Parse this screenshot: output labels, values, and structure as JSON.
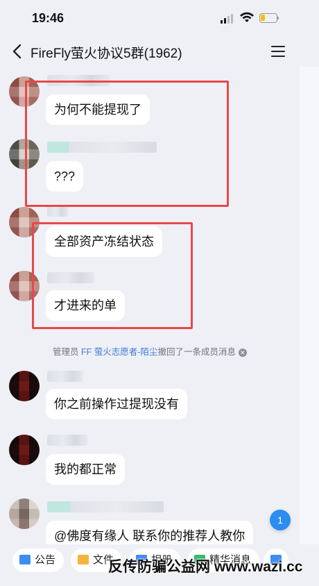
{
  "status_bar": {
    "time": "19:46"
  },
  "header": {
    "title": "FireFly萤火协议5群(1962)"
  },
  "messages": [
    {
      "text": "为何不能提现了"
    },
    {
      "text": "???"
    },
    {
      "text": "全部资产冻结状态"
    },
    {
      "text": "才进来的单"
    },
    {
      "text": "你之前操作过提现没有"
    },
    {
      "text": "我的都正常"
    },
    {
      "text": "@佛度有缘人 联系你的推荐人教你"
    }
  ],
  "system_notice": {
    "prefix": "管理员 ",
    "admin_name": "FF 萤火志愿者-陌尘",
    "suffix": "撤回了一条成员消息"
  },
  "unread_badge": "1",
  "toolbar": {
    "announcement": "公告",
    "files": "文件",
    "album": "相册",
    "essence": "精华消息"
  },
  "watermark": "反传防骗公益网 www.wazi.cc",
  "colors": {
    "highlight_box": "#e8484b",
    "accent": "#2d8cf0",
    "admin_link": "#3f7ad8"
  }
}
